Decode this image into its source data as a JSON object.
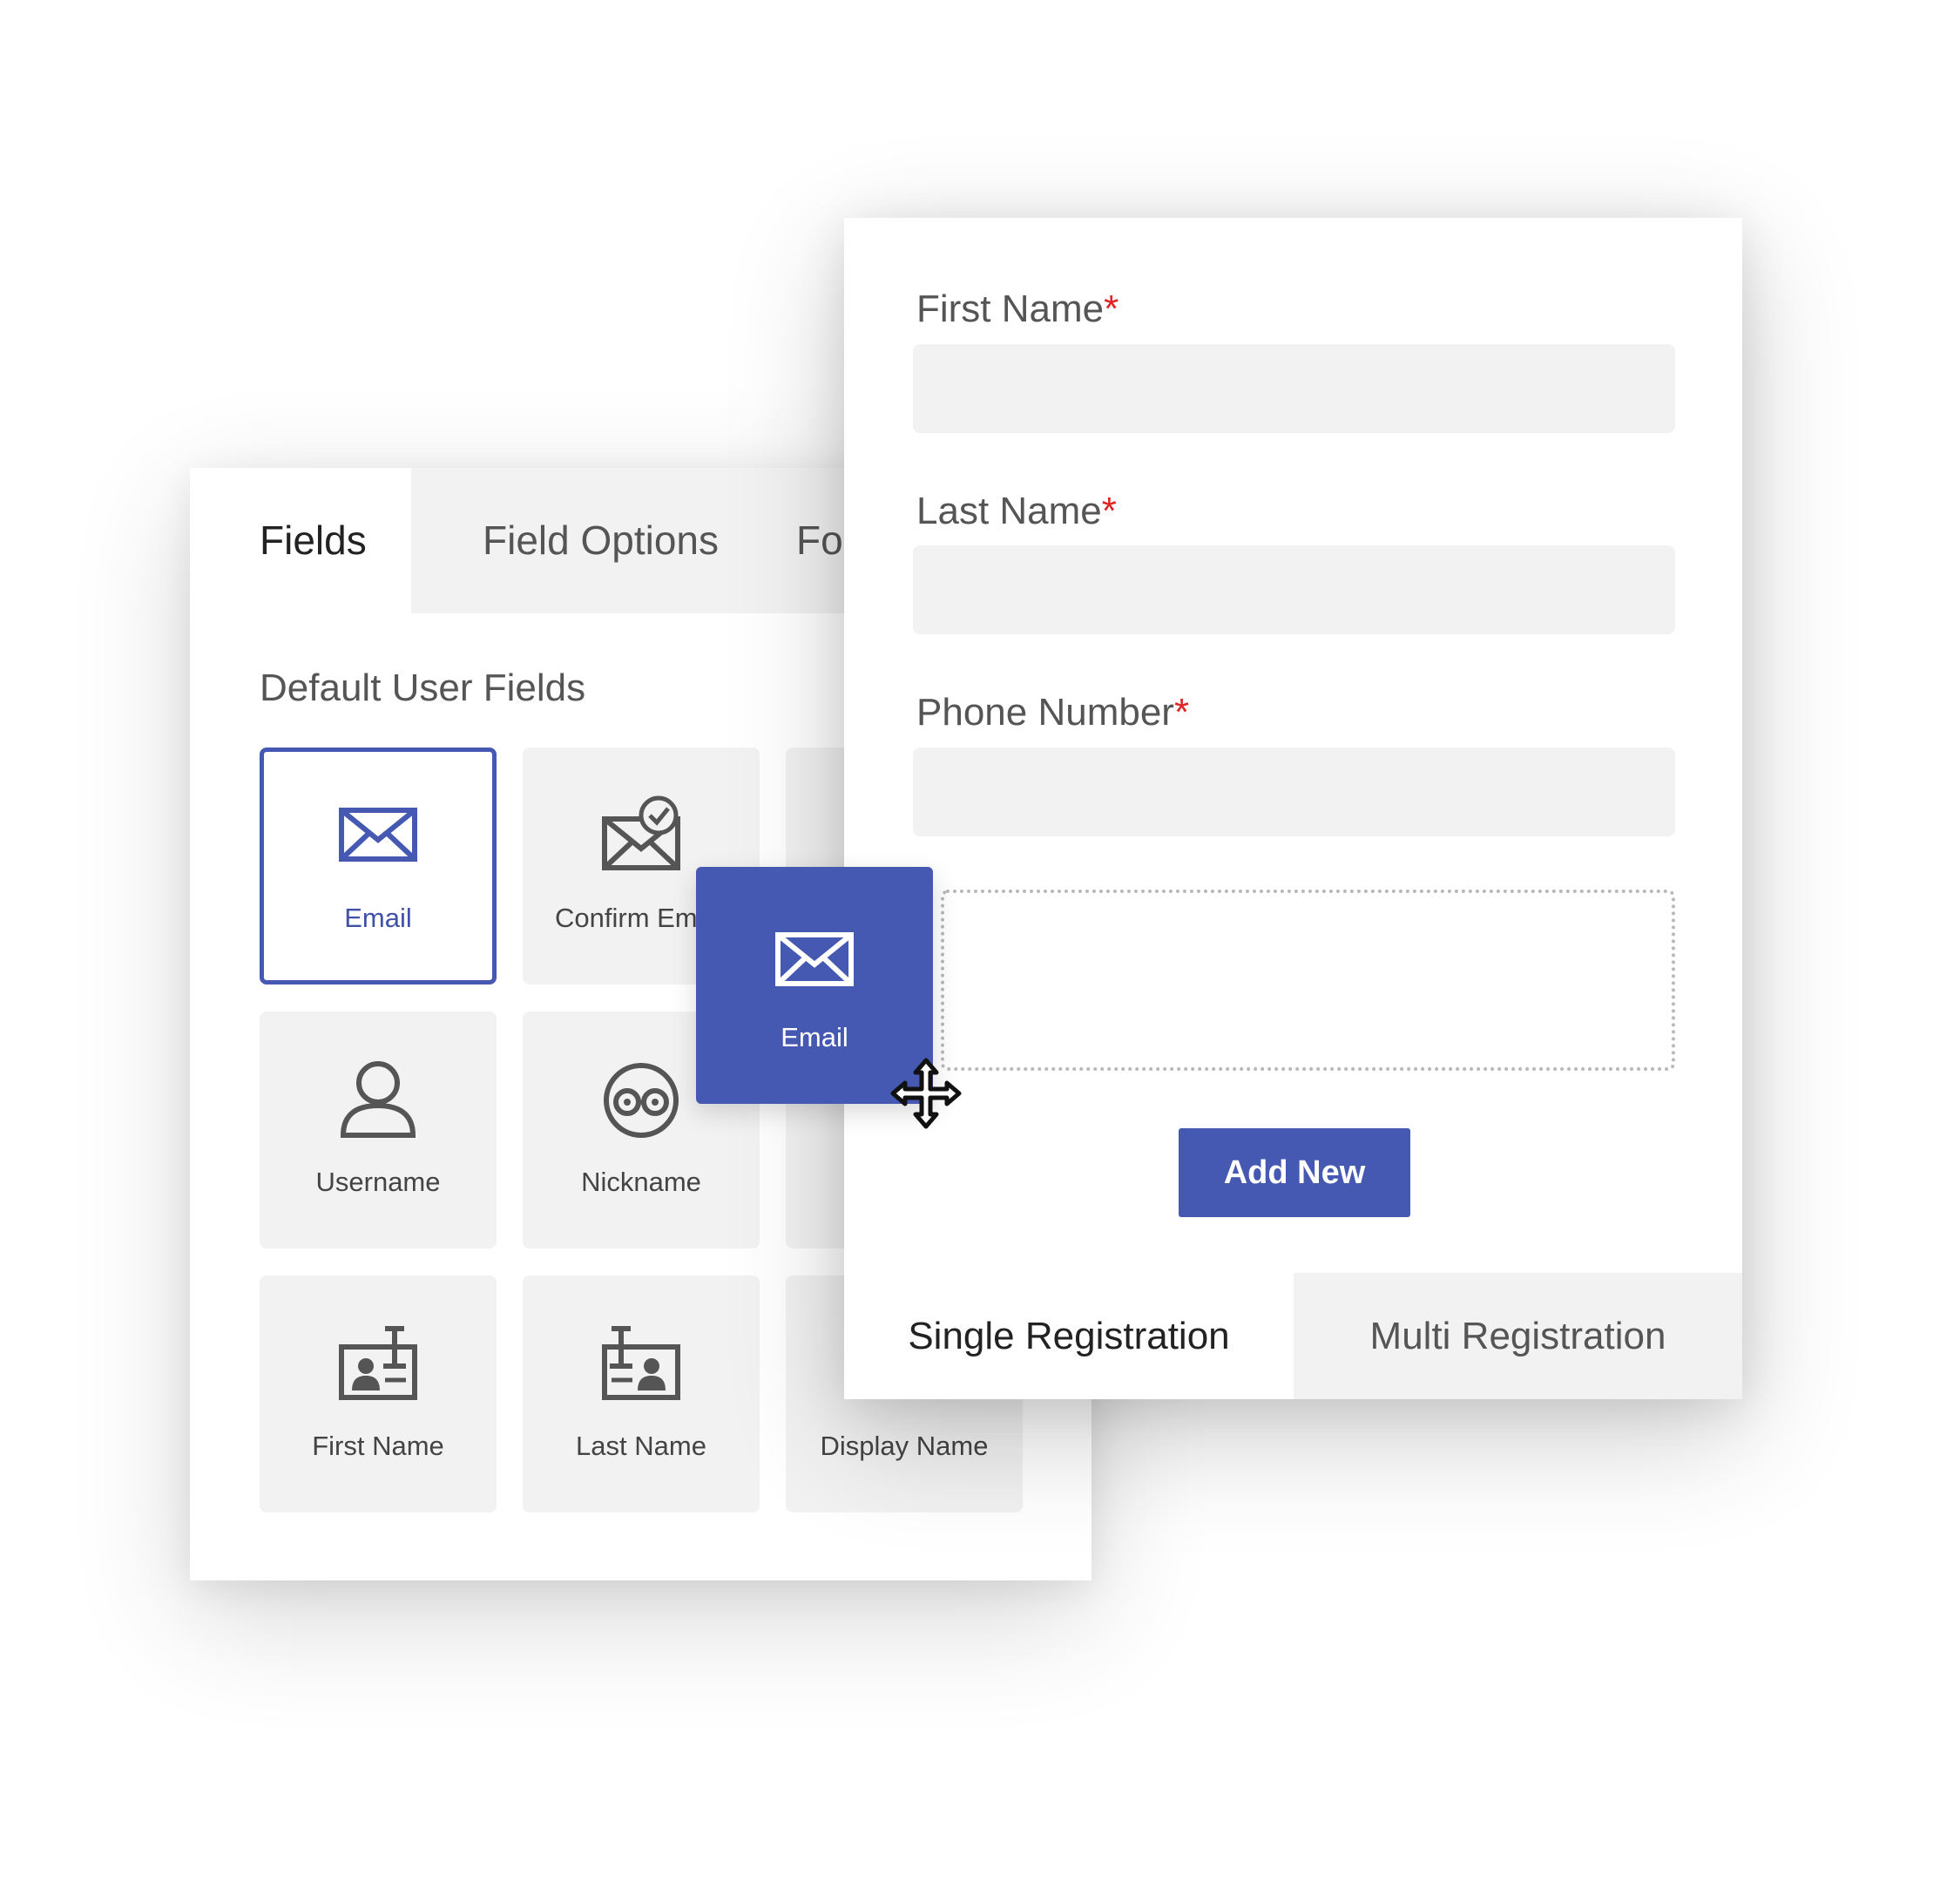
{
  "builder": {
    "tabs": [
      {
        "label": "Fields"
      },
      {
        "label": "Field Options"
      },
      {
        "label": "For"
      }
    ],
    "section_title": "Default User Fields",
    "fields": [
      {
        "label": "Email",
        "icon": "email-icon"
      },
      {
        "label": "Confirm Em",
        "icon": "confirm-email-icon"
      },
      {
        "label": "",
        "icon": ""
      },
      {
        "label": "Username",
        "icon": "user-icon"
      },
      {
        "label": "Nickname",
        "icon": "nickname-icon"
      },
      {
        "label": "",
        "icon": ""
      },
      {
        "label": "First Name",
        "icon": "id-card-icon"
      },
      {
        "label": "Last Name",
        "icon": "id-card-icon"
      },
      {
        "label": "Display Name",
        "icon": ""
      }
    ]
  },
  "form": {
    "fields": [
      {
        "label": "First Name",
        "required": "*",
        "value": ""
      },
      {
        "label": "Last Name",
        "required": "*",
        "value": ""
      },
      {
        "label": "Phone Number",
        "required": "*",
        "value": ""
      }
    ],
    "add_button": "Add New",
    "registration_tabs": [
      {
        "label": "Single Registration"
      },
      {
        "label": "Multi Registration"
      }
    ]
  },
  "drag_item": {
    "label": "Email",
    "icon": "email-icon"
  },
  "cursor": {
    "icon": "move-cursor-icon"
  },
  "colors": {
    "accent": "#4558b2",
    "required": "#e02424",
    "tile_bg": "#f2f2f2",
    "icon": "#555555"
  }
}
